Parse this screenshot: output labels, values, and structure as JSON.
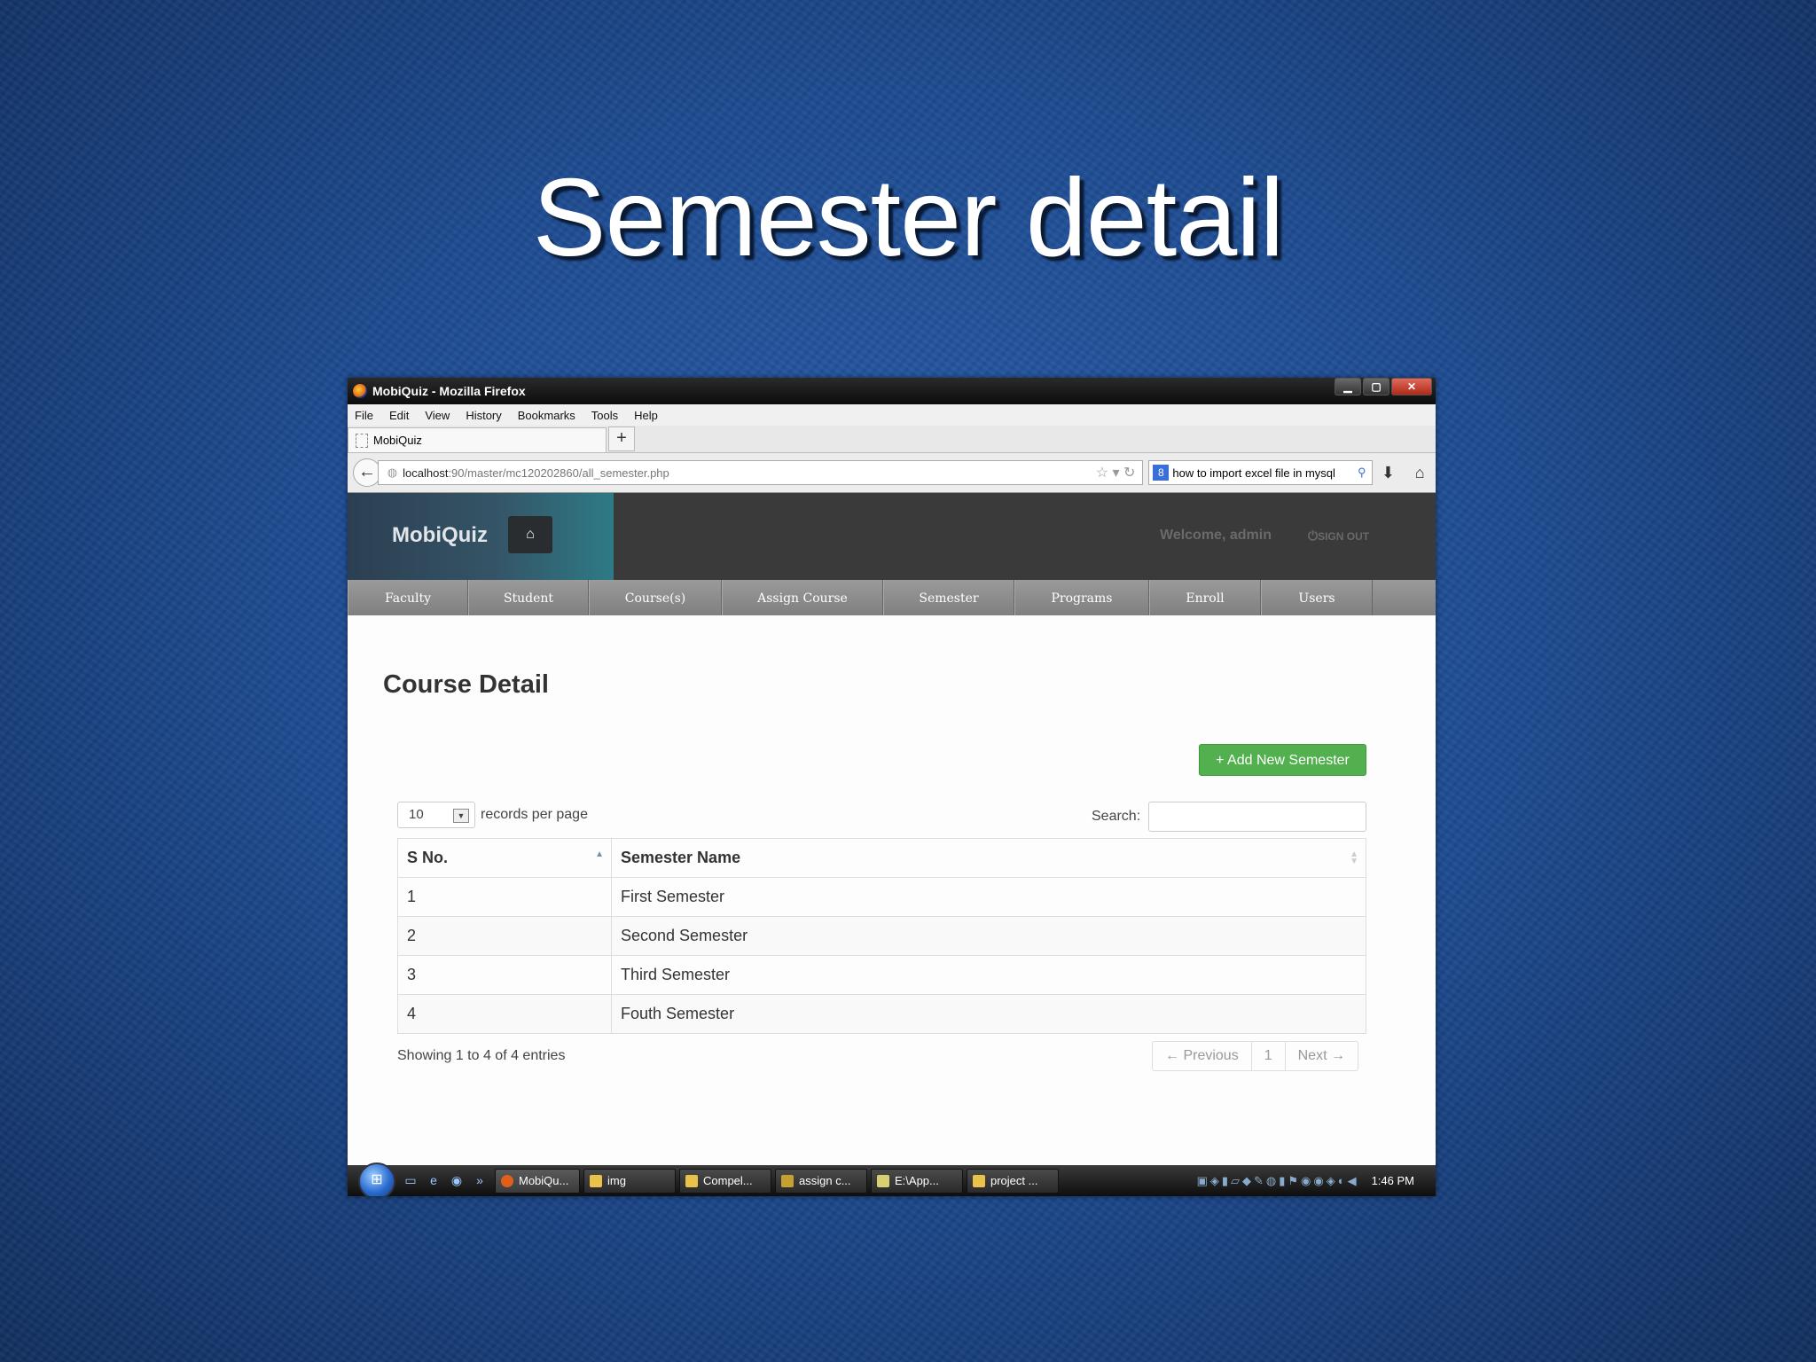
{
  "slide": {
    "title": "Semester detail"
  },
  "browser": {
    "window_title": "MobiQuiz - Mozilla Firefox",
    "menu": [
      "File",
      "Edit",
      "View",
      "History",
      "Bookmarks",
      "Tools",
      "Help"
    ],
    "tab_title": "MobiQuiz",
    "url_host": "localhost",
    "url_rest": ":90/master/mc120202860/all_semester.php",
    "search_text": "how to import excel file in mysql"
  },
  "app": {
    "brand": "MobiQuiz",
    "welcome": "Welcome, admin",
    "signout": "SIGN OUT",
    "nav": [
      "Faculty",
      "Student",
      "Course(s)",
      "Assign Course",
      "Semester",
      "Programs",
      "Enroll",
      "Users"
    ],
    "page_title": "Course Detail",
    "add_button": "+ Add New Semester",
    "per_page_value": "10",
    "per_page_label": "records per page",
    "search_label": "Search:",
    "columns": [
      "S No.",
      "Semester Name"
    ],
    "rows": [
      {
        "sno": "1",
        "name": "First Semester"
      },
      {
        "sno": "2",
        "name": "Second Semester"
      },
      {
        "sno": "3",
        "name": "Third Semester"
      },
      {
        "sno": "4",
        "name": "Fouth Semester"
      }
    ],
    "info": "Showing 1 to 4 of 4 entries",
    "pager": {
      "prev": "← Previous",
      "page": "1",
      "next": "Next →"
    }
  },
  "taskbar": {
    "items": [
      "MobiQu...",
      "img",
      "Compel...",
      "assign c...",
      "E:\\App...",
      "project ..."
    ],
    "clock": "1:46 PM"
  }
}
